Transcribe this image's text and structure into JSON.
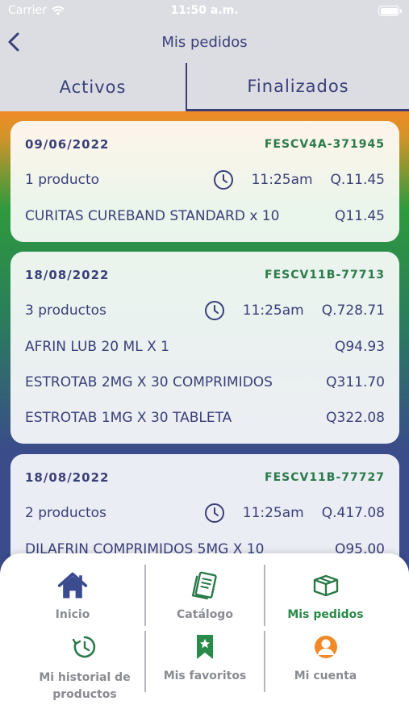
{
  "status_bar": {
    "carrier": "Carrier",
    "time": "11:50 a.m."
  },
  "nav": {
    "title": "Mis pedidos"
  },
  "tabs": [
    {
      "label": "Activos",
      "selected": false
    },
    {
      "label": "Finalizados",
      "selected": true
    }
  ],
  "orders": [
    {
      "date": "09/06/2022",
      "code": "FESCV4A-371945",
      "count": "1 producto",
      "time": "11:25am",
      "total": "Q.11.45",
      "items": [
        {
          "name": "CURITAS CUREBAND STANDARD x 10",
          "price": "Q11.45"
        }
      ]
    },
    {
      "date": "18/08/2022",
      "code": "FESCV11B-77713",
      "count": "3 productos",
      "time": "11:25am",
      "total": "Q.728.71",
      "items": [
        {
          "name": "AFRIN LUB 20 ML X 1",
          "price": "Q94.93"
        },
        {
          "name": "ESTROTAB 2MG X 30 COMPRIMIDOS",
          "price": "Q311.70"
        },
        {
          "name": "ESTROTAB 1MG X 30 TABLETA",
          "price": "Q322.08"
        }
      ]
    },
    {
      "date": "18/08/2022",
      "code": "FESCV11B-77727",
      "count": "2 productos",
      "time": "11:25am",
      "total": "Q.417.08",
      "items": [
        {
          "name": "DILAFRIN COMPRIMIDOS 5MG X 10",
          "price": "Q95.00"
        }
      ]
    }
  ],
  "menu": [
    {
      "label": "Inicio",
      "icon": "home-icon"
    },
    {
      "label": "Catálogo",
      "icon": "catalog-icon"
    },
    {
      "label": "Mis pedidos",
      "icon": "box-icon",
      "selected": true
    },
    {
      "label": "Mi historial de productos",
      "icon": "history-icon"
    },
    {
      "label": "Mis favoritos",
      "icon": "bookmark-icon"
    },
    {
      "label": "Mi cuenta",
      "icon": "user-icon"
    }
  ],
  "colors": {
    "primary": "#3a3f78",
    "accent_green": "#2a8a4a",
    "orange": "#ef8a26",
    "muted": "#8a8c92"
  }
}
